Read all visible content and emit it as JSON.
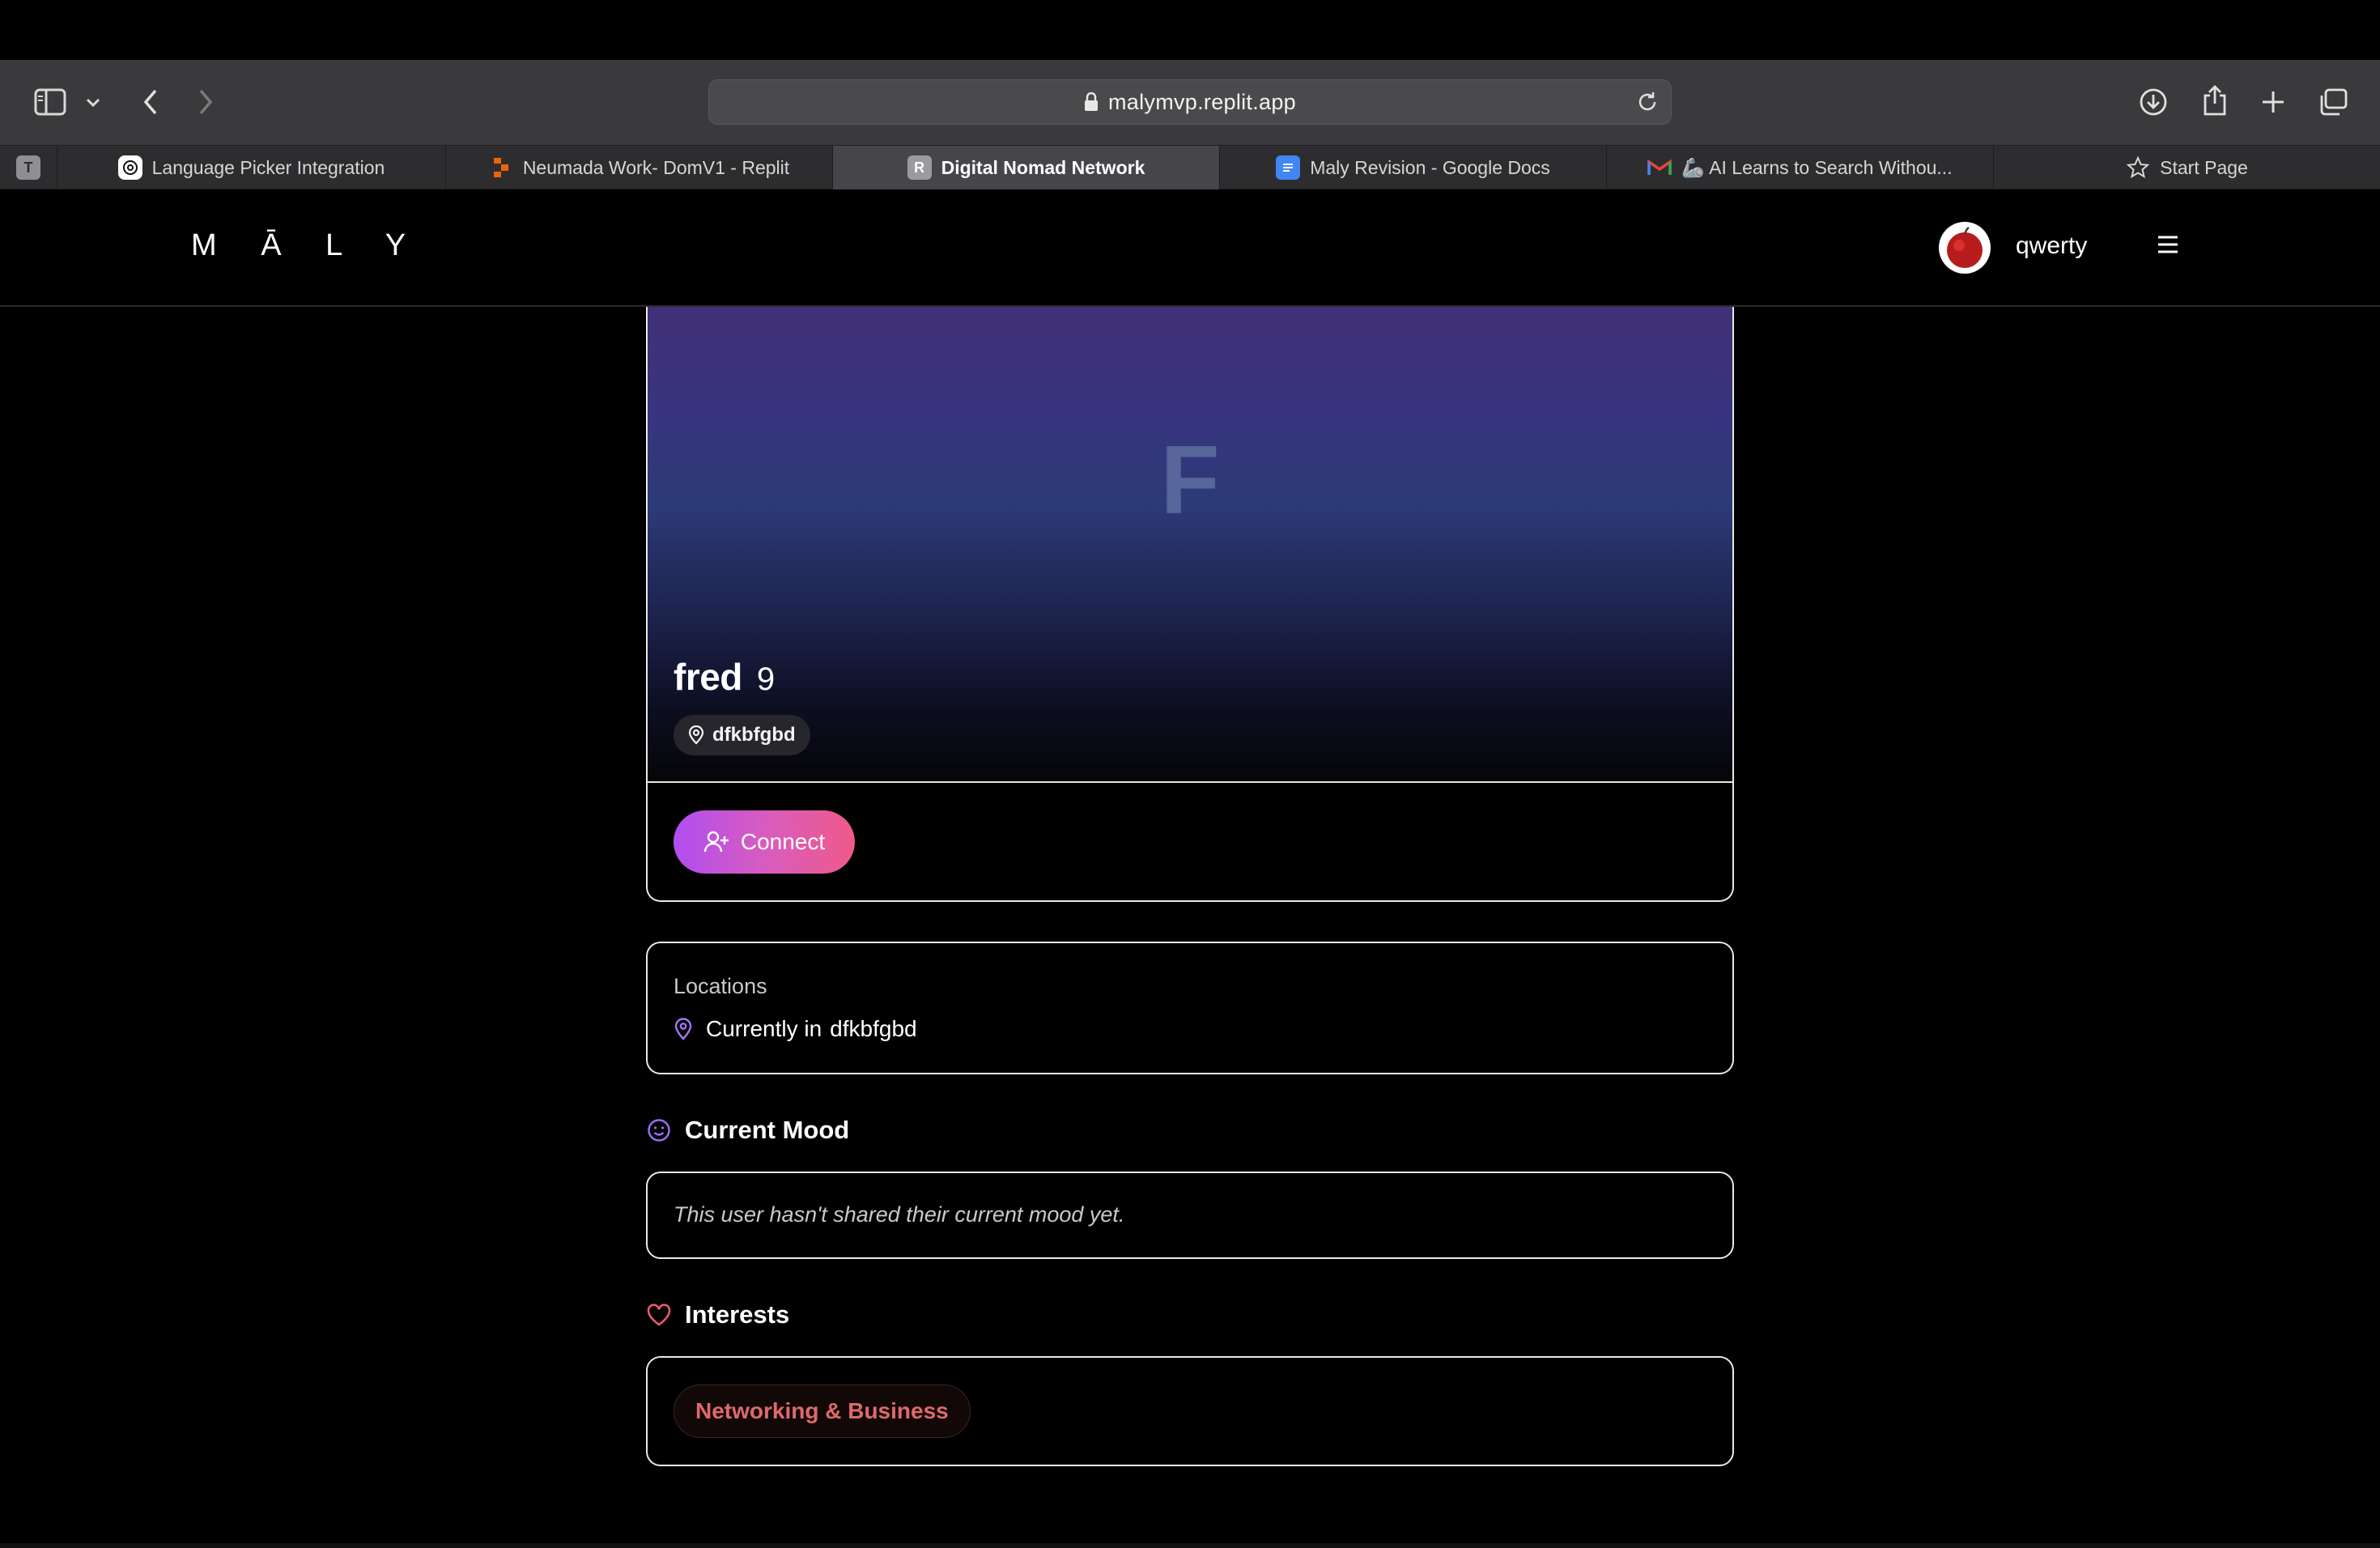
{
  "browser": {
    "url": "malymvp.replit.app",
    "tabs": [
      {
        "label": "T",
        "favicon": "T",
        "kind": "pinned"
      },
      {
        "label": "Language Picker Integration",
        "favicon": "openai-icon"
      },
      {
        "label": "Neumada Work- DomV1 - Replit",
        "favicon": "replit-icon"
      },
      {
        "label": "Digital Nomad Network",
        "favicon": "R",
        "active": true
      },
      {
        "label": "Maly Revision - Google Docs",
        "favicon": "google-docs-icon"
      },
      {
        "label": "🦾 AI Learns to Search Withou...",
        "favicon": "gmail-icon"
      },
      {
        "label": "Start Page",
        "favicon": "star-icon"
      }
    ]
  },
  "header": {
    "logo": "M Ā L Y",
    "username": "qwerty"
  },
  "profile": {
    "initial": "F",
    "name": "fred",
    "age": "9",
    "location": "dfkbfgbd",
    "connect_label": "Connect"
  },
  "locations": {
    "title": "Locations",
    "prefix": "Currently in",
    "place": "dfkbfgbd"
  },
  "mood": {
    "title": "Current Mood",
    "text": "This user hasn't shared their current mood yet."
  },
  "interests": {
    "title": "Interests",
    "tags": [
      "Networking & Business"
    ]
  },
  "colors": {
    "accent_purple": "#b14df0",
    "accent_pink": "#ef5a8a",
    "interest_red": "#e0696c"
  }
}
